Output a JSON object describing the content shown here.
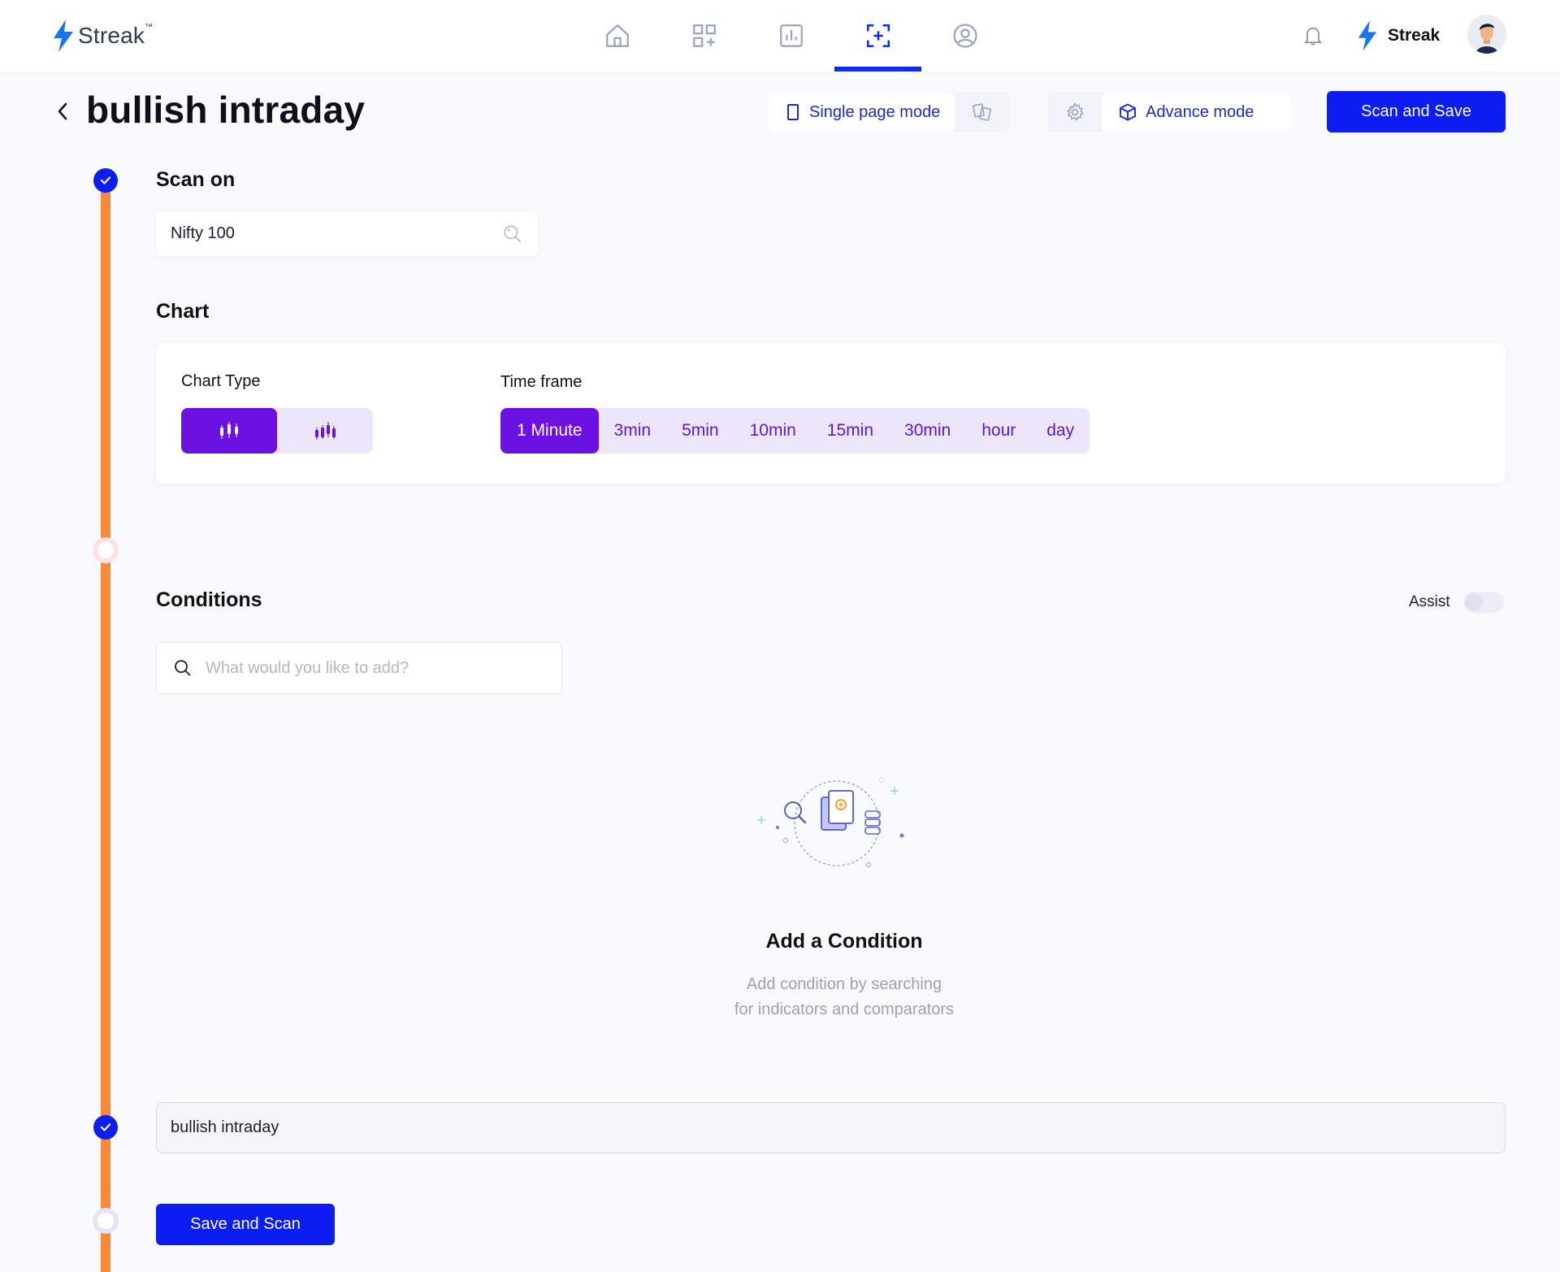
{
  "app": {
    "brand": "Streak",
    "brand_tm": "™",
    "user_brand": "Streak"
  },
  "nav": {
    "items": [
      "home-icon",
      "grid-add-icon",
      "chart-icon",
      "scan-icon",
      "user-icon"
    ],
    "active": "scan-icon"
  },
  "header": {
    "title": "bullish intraday",
    "single_page_mode": "Single page mode",
    "advance_mode": "Advance mode",
    "scan_and_save": "Scan and Save"
  },
  "scan_on": {
    "label": "Scan on",
    "value": "Nifty 100"
  },
  "chart": {
    "label": "Chart",
    "chart_type_label": "Chart Type",
    "chart_types": [
      "candlestick-icon",
      "heikin-ashi-icon"
    ],
    "chart_type_selected": "candlestick-icon",
    "timeframe_label": "Time frame",
    "timeframes": [
      "1 Minute",
      "3min",
      "5min",
      "10min",
      "15min",
      "30min",
      "hour",
      "day"
    ],
    "timeframe_selected": "1 Minute"
  },
  "conditions": {
    "label": "Conditions",
    "assist_label": "Assist",
    "assist_on": false,
    "search_placeholder": "What would you like to add?",
    "empty_title": "Add a Condition",
    "empty_sub_line1": "Add condition by searching",
    "empty_sub_line2": "for indicators and comparators"
  },
  "footer": {
    "scan_name": "bullish intraday",
    "save_and_scan": "Save and Scan"
  },
  "colors": {
    "primary": "#0b1df0",
    "purple": "#6b12e3",
    "rail": "#f6893a"
  }
}
